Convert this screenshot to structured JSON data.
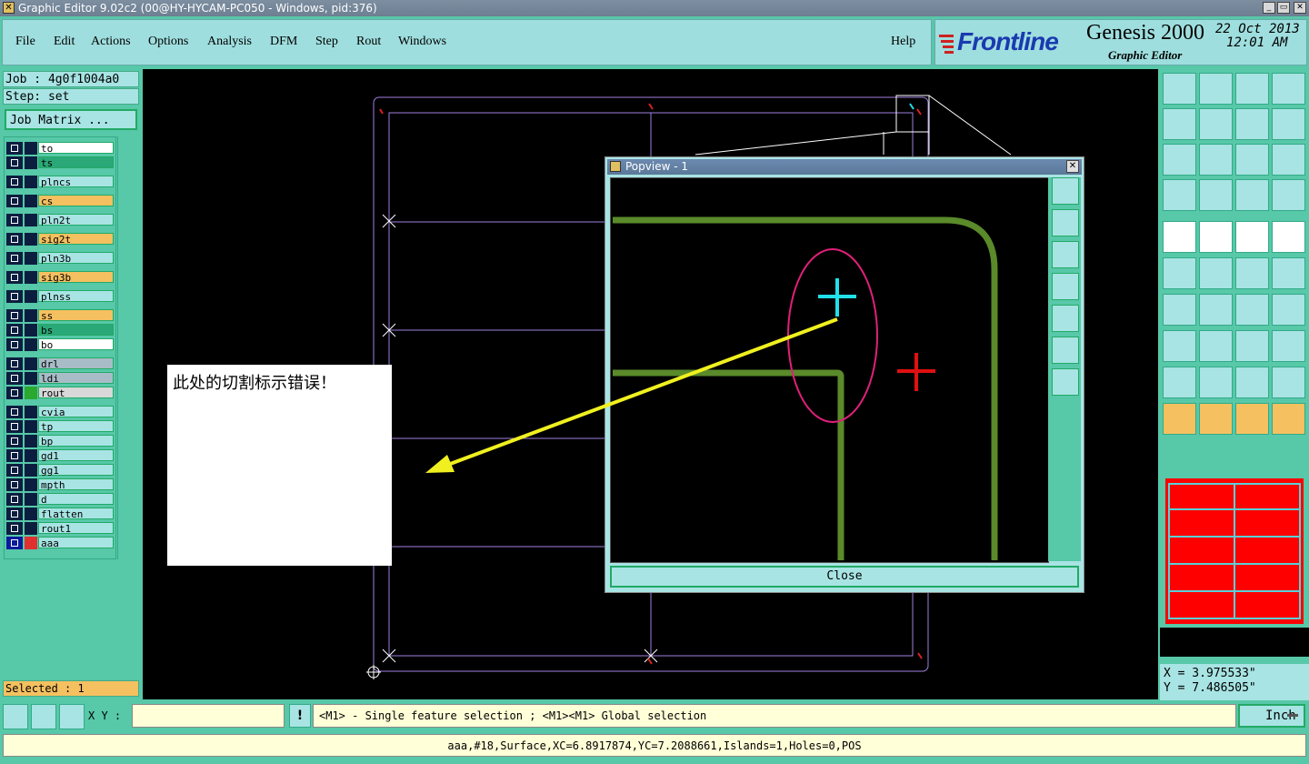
{
  "window": {
    "title": "Graphic Editor 9.02c2 (00@HY-HYCAM-PC050 - Windows, pid:376)"
  },
  "menu": [
    "File",
    "Edit",
    "Actions",
    "Options",
    "Analysis",
    "DFM",
    "Step",
    "Rout",
    "Windows"
  ],
  "help_label": "Help",
  "brand": {
    "name": "Frontline",
    "product": "Genesis 2000",
    "subtitle": "Graphic Editor",
    "date": "22 Oct 2013",
    "time": "12:01 AM"
  },
  "job": {
    "job_text": "Job : 4g0f1004a0",
    "step_text": "Step: set",
    "matrix_button": "Job Matrix ..."
  },
  "layers": [
    {
      "name": "to",
      "color": "#ffffff"
    },
    {
      "name": "ts",
      "color": "#2aa878"
    },
    {
      "name": "plncs",
      "color": "#a8e4e4"
    },
    {
      "name": "cs",
      "color": "#f5c060"
    },
    {
      "name": "pln2t",
      "color": "#a8e4e4"
    },
    {
      "name": "sig2t",
      "color": "#f5c060"
    },
    {
      "name": "pln3b",
      "color": "#a8e4e4"
    },
    {
      "name": "sig3b",
      "color": "#f5c060"
    },
    {
      "name": "plnss",
      "color": "#a8e4e4"
    },
    {
      "name": "ss",
      "color": "#f5c060"
    },
    {
      "name": "bs",
      "color": "#2aa878"
    },
    {
      "name": "bo",
      "color": "#ffffff"
    },
    {
      "name": "drl",
      "color": "#a8bcc8"
    },
    {
      "name": "ldi",
      "color": "#a8bcc8"
    },
    {
      "name": "rout",
      "color": "#d8d8d8"
    },
    {
      "name": "cvia",
      "color": "#a8e4e4"
    },
    {
      "name": "tp",
      "color": "#a8e4e4"
    },
    {
      "name": "bp",
      "color": "#a8e4e4"
    },
    {
      "name": "gd1",
      "color": "#a8e4e4"
    },
    {
      "name": "gg1",
      "color": "#a8e4e4"
    },
    {
      "name": "mpth",
      "color": "#a8e4e4"
    },
    {
      "name": "d",
      "color": "#a8e4e4"
    },
    {
      "name": "flatten",
      "color": "#a8e4e4"
    },
    {
      "name": "rout1",
      "color": "#a8e4e4"
    },
    {
      "name": "aaa",
      "color": "#a8e4e4"
    }
  ],
  "selected_text": "Selected : 1",
  "annotation_text": "此处的切割标示错误！",
  "popview": {
    "title": "Popview - 1",
    "close_label": "Close"
  },
  "coords": {
    "x_text": "X = 3.975533\"",
    "y_text": "Y = 7.486505\""
  },
  "xy_label": "X Y :",
  "status_text": "<M1> - Single feature selection ; <M1><M1> Global selection",
  "unit_label": "Inch",
  "info_text": "aaa,#18,Surface,XC=6.8917874,YC=7.2088661,Islands=1,Holes=0,POS",
  "colors": {
    "canvas": "#000000",
    "outline": "#9f7fe0",
    "trace": "#5a8a2a",
    "cross_cyan": "#20e0e8",
    "cross_red": "#e01010",
    "highlight": "#e0207a",
    "arrow": "#f0f020",
    "thumbnail": "#ff0000"
  }
}
